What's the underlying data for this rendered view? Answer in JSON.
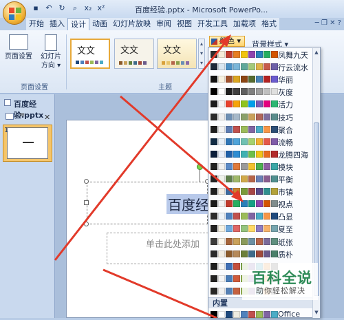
{
  "window": {
    "title": "百度经验.pptx - Microsoft PowerPo..."
  },
  "qat": {
    "icons": [
      "save-icon",
      "undo-icon",
      "redo-icon",
      "print-preview-icon",
      "subscript-icon",
      "superscript-icon"
    ],
    "subscript": "x₂",
    "superscript": "x²"
  },
  "tabs": [
    "开始",
    "插入",
    "设计",
    "动画",
    "幻灯片放映",
    "审阅",
    "视图",
    "开发工具",
    "加载项",
    "格式"
  ],
  "active_tab": "设计",
  "ribbon": {
    "page_setup": {
      "btn1": "页面设置",
      "btn2a": "幻灯片",
      "btn2b": "方向",
      "group": "页面设置"
    },
    "themes": {
      "sample": "文文",
      "group": "主题"
    },
    "colors_button": "颜色",
    "background_styles": "背景样式"
  },
  "slides_pane": {
    "tab_label": "百度经验.pptx",
    "slide_number": "1"
  },
  "slide": {
    "title": "百度经",
    "subtitle": "单击此处添加"
  },
  "schemes": [
    {
      "name": "凤舞九天",
      "colors": [
        "#2f2f2f",
        "#f5ecd8",
        "#c0392b",
        "#e67e22",
        "#f1c40f",
        "#8e44ad",
        "#2980b9",
        "#27ae60",
        "#d35400"
      ]
    },
    {
      "name": "行云流水",
      "colors": [
        "#1e2a3a",
        "#d8e6f0",
        "#4a90c4",
        "#7bb6d9",
        "#5fa89a",
        "#a3c97a",
        "#e0b34a",
        "#c75a4a",
        "#6d5fa8"
      ]
    },
    {
      "name": "华丽",
      "colors": [
        "#111111",
        "#f6f1e0",
        "#a0522d",
        "#daa520",
        "#8b4513",
        "#556b2f",
        "#4682b4",
        "#b22222",
        "#6a5acd"
      ]
    },
    {
      "name": "灰度",
      "colors": [
        "#000000",
        "#ffffff",
        "#1f1f1f",
        "#3f3f3f",
        "#5f5f5f",
        "#7f7f7f",
        "#9f9f9f",
        "#bfbfbf",
        "#dfdfdf"
      ]
    },
    {
      "name": "活力",
      "colors": [
        "#1c1c1c",
        "#f4f4f4",
        "#e8412c",
        "#f5a30a",
        "#8fc31f",
        "#00a0e9",
        "#7b5bb5",
        "#e4007f",
        "#2bb673"
      ]
    },
    {
      "name": "技巧",
      "colors": [
        "#2b2b2b",
        "#eeeeee",
        "#6e8fb3",
        "#a6b8c9",
        "#8aa06a",
        "#c9a15b",
        "#b0665a",
        "#7f6f9f",
        "#5a8c8c"
      ]
    },
    {
      "name": "聚合",
      "colors": [
        "#1d1d1d",
        "#f2f2f2",
        "#5c7cb2",
        "#c0504d",
        "#9bbb59",
        "#8064a2",
        "#4bacc6",
        "#f79646",
        "#2c4d75"
      ]
    },
    {
      "name": "流畅",
      "colors": [
        "#0f2a44",
        "#e6eef6",
        "#2e75b6",
        "#4fa3d9",
        "#70c1b3",
        "#a5d16f",
        "#f2b134",
        "#e5594a",
        "#7f5ba8"
      ]
    },
    {
      "name": "龙腾四海",
      "colors": [
        "#0c1f3b",
        "#e8eef8",
        "#1f5fa8",
        "#2d8cd2",
        "#3fb1b1",
        "#6cbf4a",
        "#f0c419",
        "#e86b1f",
        "#b22b2b"
      ]
    },
    {
      "name": "模块",
      "colors": [
        "#222222",
        "#f0f0f0",
        "#5b8ac6",
        "#e07a3a",
        "#9a9a9a",
        "#f2c12e",
        "#4caf50",
        "#8e5ea2",
        "#3aa6a6"
      ]
    },
    {
      "name": "平衡",
      "colors": [
        "#242424",
        "#eef1ea",
        "#5e7e4a",
        "#9fb86a",
        "#d0a94a",
        "#b5654a",
        "#6a7fb5",
        "#8a5d8f",
        "#4f8f8f"
      ]
    },
    {
      "name": "市镇",
      "colors": [
        "#1f1f1f",
        "#f4efe6",
        "#3b6aa0",
        "#c9842f",
        "#7a9a3a",
        "#a64646",
        "#5a4a8a",
        "#2f8f8f",
        "#b3a23a"
      ]
    },
    {
      "name": "视点",
      "colors": [
        "#1a1a1a",
        "#f2f2f2",
        "#c0392b",
        "#27ae60",
        "#2980b9",
        "#16a085",
        "#8e44ad",
        "#d35400",
        "#7f8c8d"
      ]
    },
    {
      "name": "凸显",
      "colors": [
        "#2c2c2c",
        "#eef3f8",
        "#4f81bd",
        "#c0504d",
        "#9bbb59",
        "#8064a2",
        "#4bacc6",
        "#f79646",
        "#1f497d"
      ]
    },
    {
      "name": "夏至",
      "colors": [
        "#202020",
        "#f7f3e6",
        "#6fa8dc",
        "#e06666",
        "#93c47d",
        "#ffd966",
        "#8e7cc3",
        "#f6b26b",
        "#76a5af"
      ]
    },
    {
      "name": "纸张",
      "colors": [
        "#3a3a3a",
        "#faf6ec",
        "#a5643a",
        "#c9a15b",
        "#8a9a5b",
        "#6b8fa3",
        "#b5654a",
        "#7a6a9a",
        "#5f8f7f"
      ]
    },
    {
      "name": "质朴",
      "colors": [
        "#2a2a2a",
        "#f1ece2",
        "#8b5a2b",
        "#b5895a",
        "#6b7f3a",
        "#3f6b8a",
        "#a04a3a",
        "#6a5a8a",
        "#4a7f6a"
      ]
    },
    {
      "name": "",
      "colors": [
        "#1e1e1e",
        "#f4f4f4",
        "#3f6fb5",
        "#c44f3d",
        "#7fa84a",
        "#7a5fa8",
        "#3aa0b8",
        "#e38a2f",
        "#5a5a5a"
      ]
    },
    {
      "name": "",
      "colors": [
        "#222222",
        "#f5f5f5",
        "#4a7db8",
        "#d05a3a",
        "#8fb04a",
        "#8a6ab8",
        "#4ab0c8",
        "#f0a040",
        "#6a6a6a"
      ]
    },
    {
      "name": "",
      "colors": [
        "#262626",
        "#f0f0f0",
        "#5580b5",
        "#c4603f",
        "#96b354",
        "#866aa8",
        "#53a8bd",
        "#e59a48",
        "#747474"
      ]
    }
  ],
  "builtin_header": "内置",
  "office_scheme": {
    "name": "Office",
    "colors": [
      "#000000",
      "#ffffff",
      "#1f497d",
      "#eeece1",
      "#4f81bd",
      "#c0504d",
      "#9bbb59",
      "#8064a2",
      "#4bacc6"
    ]
  },
  "watermark": {
    "logo": "百科全说",
    "sub": "助你轻松解决"
  }
}
